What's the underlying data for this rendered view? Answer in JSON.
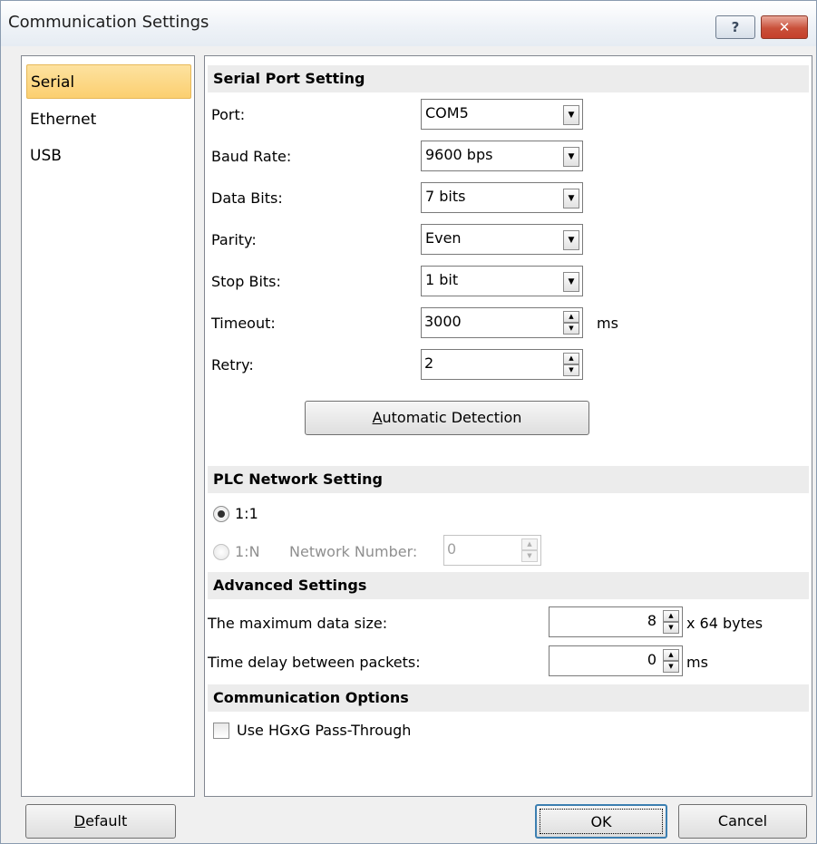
{
  "window": {
    "title": "Communication Settings",
    "help_glyph": "?",
    "close_glyph": "✕"
  },
  "sidebar": {
    "items": [
      {
        "label": "Serial"
      },
      {
        "label": "Ethernet"
      },
      {
        "label": "USB"
      }
    ]
  },
  "serial_port": {
    "header": "Serial Port Setting",
    "port": {
      "label": "Port:",
      "value": "COM5"
    },
    "baud_rate": {
      "label": "Baud Rate:",
      "value": "9600 bps"
    },
    "data_bits": {
      "label": "Data Bits:",
      "value": "7 bits"
    },
    "parity": {
      "label": "Parity:",
      "value": "Even"
    },
    "stop_bits": {
      "label": "Stop Bits:",
      "value": "1 bit"
    },
    "timeout": {
      "label": "Timeout:",
      "value": "3000",
      "unit": "ms"
    },
    "retry": {
      "label": "Retry:",
      "value": "2"
    },
    "auto_detect": {
      "mnemonic": "A",
      "rest": "utomatic Detection"
    }
  },
  "plc_network": {
    "header": "PLC Network Setting",
    "option_1to1": {
      "label": "1:1",
      "checked": true
    },
    "option_1toN": {
      "label": "1:N",
      "checked": false
    },
    "network_number": {
      "label": "Network Number:",
      "value": "0"
    }
  },
  "advanced": {
    "header": "Advanced Settings",
    "max_data_size": {
      "label": "The maximum data size:",
      "value": "8",
      "unit": "x 64 bytes"
    },
    "time_delay": {
      "label": "Time delay between packets:",
      "value": "0",
      "unit": "ms"
    }
  },
  "comm_options": {
    "header": "Communication Options",
    "hgxg_passthrough": {
      "label": "Use HGxG Pass-Through",
      "checked": false
    }
  },
  "footer": {
    "default": {
      "mnemonic": "D",
      "rest": "efault"
    },
    "ok": "OK",
    "cancel": "Cancel"
  },
  "colors": {
    "selection": "#fbcf70",
    "section_header": "#ececec",
    "close_button": "#c9503a"
  }
}
